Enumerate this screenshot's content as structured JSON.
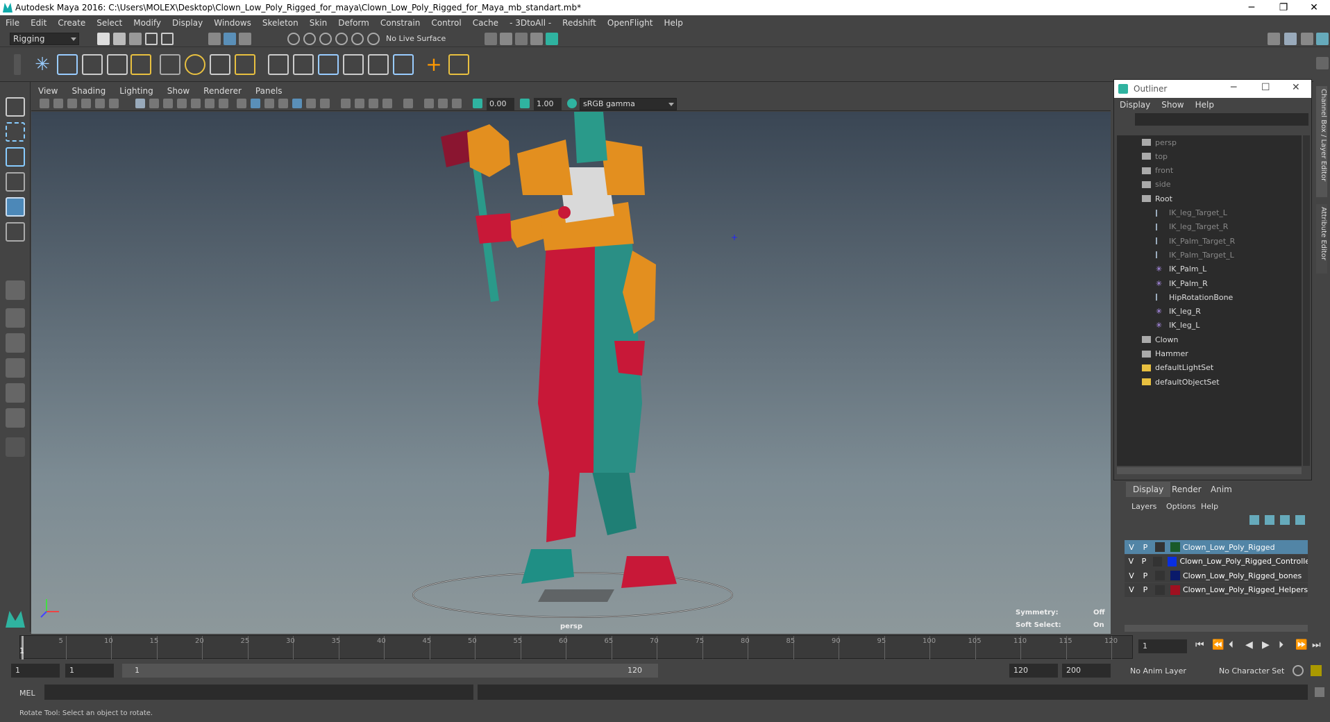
{
  "window": {
    "title": "Autodesk Maya 2016: C:\\Users\\MOLEX\\Desktop\\Clown_Low_Poly_Rigged_for_maya\\Clown_Low_Poly_Rigged_for_Maya_mb_standart.mb*",
    "min": "─",
    "restore": "❐",
    "close": "✕"
  },
  "menus": [
    "File",
    "Edit",
    "Create",
    "Select",
    "Modify",
    "Display",
    "Windows",
    "Skeleton",
    "Skin",
    "Deform",
    "Constrain",
    "Control",
    "Cache",
    "- 3DtoAll -",
    "Redshift",
    "OpenFlight",
    "Help"
  ],
  "status": {
    "menuset": "Rigging",
    "live_surface": "No Live Surface"
  },
  "viewport": {
    "menus": [
      "View",
      "Shading",
      "Lighting",
      "Show",
      "Renderer",
      "Panels"
    ],
    "near": "0.00",
    "far": "1.00",
    "colorspace": "sRGB gamma",
    "camera": "persp",
    "symmetry_label": "Symmetry:",
    "symmetry_value": "Off",
    "softsel_label": "Soft Select:",
    "softsel_value": "On"
  },
  "outliner": {
    "title": "Outliner",
    "menus": [
      "Display",
      "Show",
      "Help"
    ],
    "items": [
      {
        "label": "persp",
        "dim": true,
        "icon": "camera-icon"
      },
      {
        "label": "top",
        "dim": true,
        "icon": "camera-icon"
      },
      {
        "label": "front",
        "dim": true,
        "icon": "camera-icon"
      },
      {
        "label": "side",
        "dim": true,
        "icon": "camera-icon"
      },
      {
        "label": "Root",
        "dim": false,
        "icon": "group-icon"
      },
      {
        "label": "IK_leg_Target_L",
        "dim": true,
        "icon": "ik-icon"
      },
      {
        "label": "IK_leg_Target_R",
        "dim": true,
        "icon": "ik-icon"
      },
      {
        "label": "IK_Palm_Target_R",
        "dim": true,
        "icon": "ik-icon"
      },
      {
        "label": "IK_Palm_Target_L",
        "dim": true,
        "icon": "ik-icon"
      },
      {
        "label": "IK_Palm_L",
        "dim": false,
        "icon": "ikhandle-icon"
      },
      {
        "label": "IK_Palm_R",
        "dim": false,
        "icon": "ikhandle-icon"
      },
      {
        "label": "HipRotationBone",
        "dim": false,
        "icon": "joint-icon"
      },
      {
        "label": "IK_leg_R",
        "dim": false,
        "icon": "ikhandle-icon"
      },
      {
        "label": "IK_leg_L",
        "dim": false,
        "icon": "ikhandle-icon"
      },
      {
        "label": "Clown",
        "dim": false,
        "icon": "group-icon"
      },
      {
        "label": "Hammer",
        "dim": false,
        "icon": "group-icon"
      },
      {
        "label": "defaultLightSet",
        "dim": false,
        "icon": "set-icon"
      },
      {
        "label": "defaultObjectSet",
        "dim": false,
        "icon": "set-icon"
      }
    ]
  },
  "layers": {
    "tabs": [
      "Display",
      "Render",
      "Anim"
    ],
    "menus": [
      "Layers",
      "Options",
      "Help"
    ],
    "rows": [
      {
        "v": "V",
        "p": "P",
        "name": "Clown_Low_Poly_Rigged",
        "color": "#1a5a2a",
        "selected": true
      },
      {
        "v": "V",
        "p": "P",
        "name": "Clown_Low_Poly_Rigged_Controllers",
        "color": "#0a2fe0",
        "selected": false
      },
      {
        "v": "V",
        "p": "P",
        "name": "Clown_Low_Poly_Rigged_bones",
        "color": "#0a1a6a",
        "selected": false
      },
      {
        "v": "V",
        "p": "P",
        "name": "Clown_Low_Poly_Rigged_Helpers",
        "color": "#a01020",
        "selected": false
      }
    ]
  },
  "side_tabs": [
    "Channel Box / Layer Editor",
    "Attribute Editor"
  ],
  "timeline": {
    "ticks": [
      "5",
      "10",
      "15",
      "20",
      "25",
      "30",
      "35",
      "40",
      "45",
      "50",
      "55",
      "60",
      "65",
      "70",
      "75",
      "80",
      "85",
      "90",
      "95",
      "100",
      "105",
      "110",
      "115",
      "120"
    ],
    "first": "1",
    "current": "1"
  },
  "range": {
    "start": "1",
    "anim_start": "1",
    "slider_start": "1",
    "slider_end": "120",
    "end": "120",
    "anim_end": "200",
    "anim_layer": "No Anim Layer",
    "char_set": "No Character Set"
  },
  "cmd": {
    "label": "MEL"
  },
  "help": {
    "text": "Rotate Tool: Select an object to rotate."
  }
}
